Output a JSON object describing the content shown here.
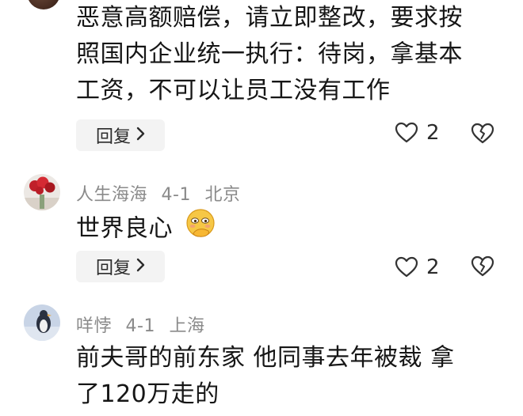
{
  "comments": [
    {
      "text_lines": [
        "恶意高额赔偿，请立即整改，要求按",
        "照国内企业统一执行：待岗，拿基本",
        "工资，不可以让员工没有工作"
      ],
      "reply_label": "回复",
      "likes": "2"
    },
    {
      "username": "人生海海",
      "date": "4-1",
      "location": "北京",
      "text": "世界良心",
      "emoji": "smiling-face-with-hand-emoji",
      "reply_label": "回复",
      "likes": "2"
    },
    {
      "username": "咩悖",
      "date": "4-1",
      "location": "上海",
      "text_lines": [
        "前夫哥的前东家 他同事去年被裁 拿",
        "了120万走的"
      ]
    }
  ],
  "icons": {
    "like": "heart-outline-icon",
    "dislike": "broken-heart-icon",
    "chevron": "chevron-right-icon"
  }
}
